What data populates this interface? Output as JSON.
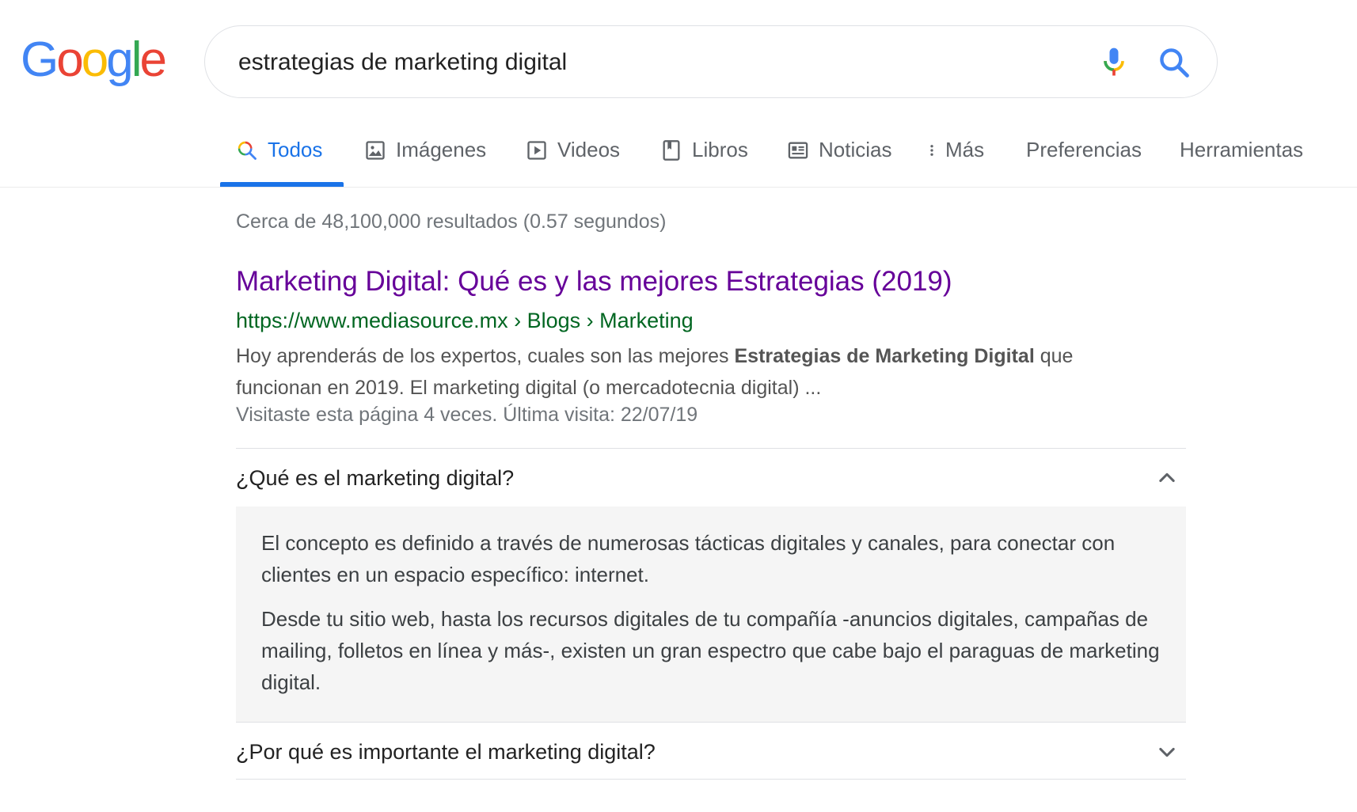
{
  "logo": {
    "letters": [
      "G",
      "o",
      "o",
      "g",
      "l",
      "e"
    ],
    "colors": [
      "#4285F4",
      "#EA4335",
      "#FBBC05",
      "#4285F4",
      "#34A853",
      "#EA4335"
    ]
  },
  "search": {
    "query": "estrategias de marketing digital",
    "mic_icon": "microphone-icon",
    "search_icon": "magnifier-icon"
  },
  "tabs": [
    {
      "label": "Todos",
      "icon": "search-icon",
      "active": true
    },
    {
      "label": "Imágenes",
      "icon": "image-icon",
      "active": false
    },
    {
      "label": "Videos",
      "icon": "play-icon",
      "active": false
    },
    {
      "label": "Libros",
      "icon": "book-icon",
      "active": false
    },
    {
      "label": "Noticias",
      "icon": "news-icon",
      "active": false
    },
    {
      "label": "Más",
      "icon": "more-vert-icon",
      "active": false
    },
    {
      "label": "Preferencias",
      "icon": "",
      "active": false
    },
    {
      "label": "Herramientas",
      "icon": "",
      "active": false
    }
  ],
  "stats": "Cerca de 48,100,000 resultados (0.57 segundos)",
  "result": {
    "title": "Marketing Digital: Qué es y las mejores Estrategias (2019)",
    "url": "https://www.mediasource.mx › Blogs › Marketing",
    "snippet_pre": "Hoy aprenderás de los expertos, cuales son las mejores ",
    "snippet_bold": "Estrategias de Marketing Digital",
    "snippet_post": " que funcionan en 2019. El marketing digital (o mercadotecnia digital) ...",
    "visited": "Visitaste esta página 4 veces. Última visita: 22/07/19"
  },
  "faq": [
    {
      "question": "¿Qué es el marketing digital?",
      "expanded": true,
      "answer": [
        "El concepto es definido a través de numerosas tácticas digitales y canales, para conectar con clientes en un espacio específico: internet.",
        "Desde tu sitio web, hasta los recursos digitales de tu compañía -anuncios digitales, campañas de mailing, folletos en línea y más-, existen un gran espectro que cabe bajo el paraguas de marketing digital."
      ]
    },
    {
      "question": "¿Por qué es importante el marketing digital?",
      "expanded": false
    }
  ],
  "colors": {
    "accent": "#1a73e8",
    "visited_link": "#660099",
    "url_green": "#006621",
    "snippet": "#545454",
    "muted": "#70757a"
  }
}
